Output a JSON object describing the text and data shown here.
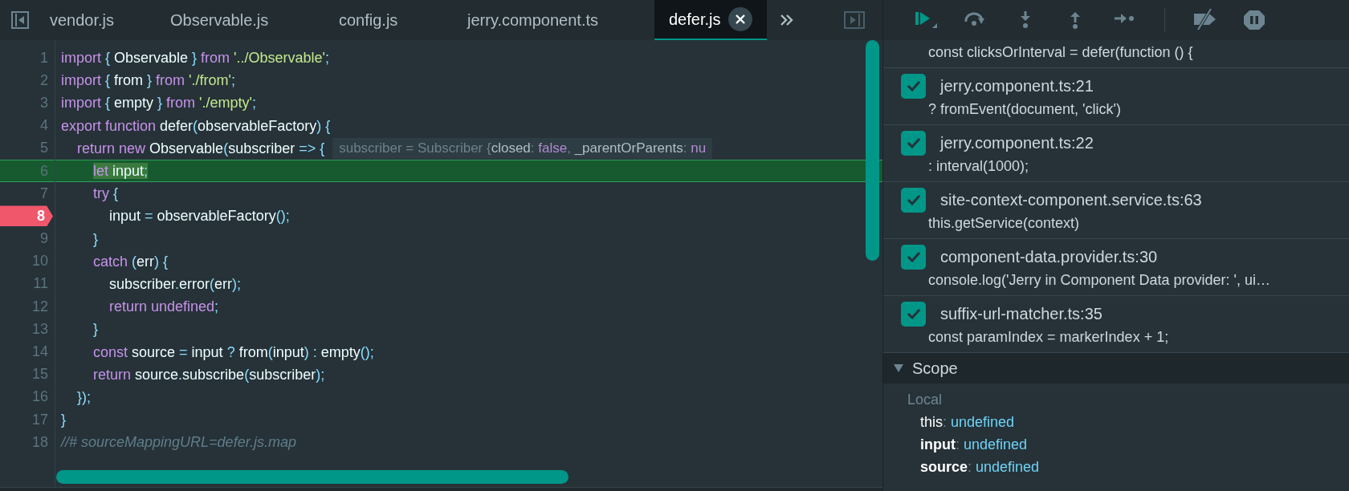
{
  "editor": {
    "tabs": [
      {
        "label": "vendor.js",
        "selected": false
      },
      {
        "label": "Observable.js",
        "selected": false
      },
      {
        "label": "config.js",
        "selected": false
      },
      {
        "label": "jerry.component.ts",
        "selected": false
      },
      {
        "label": "defer.js",
        "selected": true
      }
    ],
    "lines": [
      {
        "number": "1",
        "current": false,
        "breakpoint": false,
        "tokens": [
          {
            "kind": "k",
            "text": "import"
          },
          {
            "kind": "p",
            "text": " { "
          },
          {
            "kind": "t",
            "text": "Observable"
          },
          {
            "kind": "p",
            "text": " } "
          },
          {
            "kind": "k",
            "text": "from"
          },
          {
            "kind": "s",
            "text": " '../Observable'"
          },
          {
            "kind": "p",
            "text": ";"
          }
        ]
      },
      {
        "number": "2",
        "current": false,
        "breakpoint": false,
        "tokens": [
          {
            "kind": "k",
            "text": "import"
          },
          {
            "kind": "p",
            "text": " { "
          },
          {
            "kind": "t",
            "text": "from"
          },
          {
            "kind": "p",
            "text": " } "
          },
          {
            "kind": "k",
            "text": "from"
          },
          {
            "kind": "s",
            "text": " './from'"
          },
          {
            "kind": "p",
            "text": ";"
          }
        ]
      },
      {
        "number": "3",
        "current": false,
        "breakpoint": false,
        "tokens": [
          {
            "kind": "k",
            "text": "import"
          },
          {
            "kind": "p",
            "text": " { "
          },
          {
            "kind": "t",
            "text": "empty"
          },
          {
            "kind": "p",
            "text": " } "
          },
          {
            "kind": "k",
            "text": "from"
          },
          {
            "kind": "s",
            "text": " './empty'"
          },
          {
            "kind": "p",
            "text": ";"
          }
        ]
      },
      {
        "number": "4",
        "current": false,
        "breakpoint": false,
        "tokens": [
          {
            "kind": "k",
            "text": "export function "
          },
          {
            "kind": "t",
            "text": "defer"
          },
          {
            "kind": "p",
            "text": "("
          },
          {
            "kind": "t",
            "text": "observableFactory"
          },
          {
            "kind": "p",
            "text": ") {"
          }
        ]
      },
      {
        "number": "5",
        "current": false,
        "breakpoint": false,
        "tokens": [
          {
            "kind": "k",
            "text": "    return new "
          },
          {
            "kind": "t",
            "text": "Observable"
          },
          {
            "kind": "p",
            "text": "("
          },
          {
            "kind": "t",
            "text": "subscriber "
          },
          {
            "kind": "p",
            "text": "=> {"
          }
        ],
        "hint": [
          {
            "kind": "h",
            "text": "subscriber = Subscriber {"
          },
          {
            "kind": "hk",
            "text": "closed"
          },
          {
            "kind": "h",
            "text": ": "
          },
          {
            "kind": "hv",
            "text": "false"
          },
          {
            "kind": "h",
            "text": ", "
          },
          {
            "kind": "hk",
            "text": "_parentOrParents"
          },
          {
            "kind": "h",
            "text": ": "
          },
          {
            "kind": "hv",
            "text": "nu"
          }
        ]
      },
      {
        "number": "6",
        "current": true,
        "breakpoint": false,
        "tokens": [
          {
            "kind": "k",
            "text": "        let "
          },
          {
            "kind": "t",
            "text": "input"
          },
          {
            "kind": "p",
            "text": ";"
          }
        ]
      },
      {
        "number": "7",
        "current": false,
        "breakpoint": false,
        "tokens": [
          {
            "kind": "k",
            "text": "        try "
          },
          {
            "kind": "p",
            "text": "{"
          }
        ]
      },
      {
        "number": "8",
        "current": false,
        "breakpoint": true,
        "tokens": [
          {
            "kind": "t",
            "text": "            input "
          },
          {
            "kind": "p",
            "text": "= "
          },
          {
            "kind": "t",
            "text": "observableFactory"
          },
          {
            "kind": "p",
            "text": "();"
          }
        ]
      },
      {
        "number": "9",
        "current": false,
        "breakpoint": false,
        "tokens": [
          {
            "kind": "p",
            "text": "        }"
          }
        ]
      },
      {
        "number": "10",
        "current": false,
        "breakpoint": false,
        "tokens": [
          {
            "kind": "k",
            "text": "        catch "
          },
          {
            "kind": "p",
            "text": "("
          },
          {
            "kind": "t",
            "text": "err"
          },
          {
            "kind": "p",
            "text": ") {"
          }
        ]
      },
      {
        "number": "11",
        "current": false,
        "breakpoint": false,
        "tokens": [
          {
            "kind": "t",
            "text": "            subscriber"
          },
          {
            "kind": "p",
            "text": "."
          },
          {
            "kind": "t",
            "text": "error"
          },
          {
            "kind": "p",
            "text": "("
          },
          {
            "kind": "t",
            "text": "err"
          },
          {
            "kind": "p",
            "text": ");"
          }
        ]
      },
      {
        "number": "12",
        "current": false,
        "breakpoint": false,
        "tokens": [
          {
            "kind": "k",
            "text": "            return undefined"
          },
          {
            "kind": "p",
            "text": ";"
          }
        ]
      },
      {
        "number": "13",
        "current": false,
        "breakpoint": false,
        "tokens": [
          {
            "kind": "p",
            "text": "        }"
          }
        ]
      },
      {
        "number": "14",
        "current": false,
        "breakpoint": false,
        "tokens": [
          {
            "kind": "k",
            "text": "        const "
          },
          {
            "kind": "t",
            "text": "source "
          },
          {
            "kind": "p",
            "text": "= "
          },
          {
            "kind": "t",
            "text": "input "
          },
          {
            "kind": "p",
            "text": "? "
          },
          {
            "kind": "t",
            "text": "from"
          },
          {
            "kind": "p",
            "text": "("
          },
          {
            "kind": "t",
            "text": "input"
          },
          {
            "kind": "p",
            "text": ") : "
          },
          {
            "kind": "t",
            "text": "empty"
          },
          {
            "kind": "p",
            "text": "();"
          }
        ]
      },
      {
        "number": "15",
        "current": false,
        "breakpoint": false,
        "tokens": [
          {
            "kind": "k",
            "text": "        return "
          },
          {
            "kind": "t",
            "text": "source"
          },
          {
            "kind": "p",
            "text": "."
          },
          {
            "kind": "t",
            "text": "subscribe"
          },
          {
            "kind": "p",
            "text": "("
          },
          {
            "kind": "t",
            "text": "subscriber"
          },
          {
            "kind": "p",
            "text": ");"
          }
        ]
      },
      {
        "number": "16",
        "current": false,
        "breakpoint": false,
        "tokens": [
          {
            "kind": "p",
            "text": "    });"
          }
        ]
      },
      {
        "number": "17",
        "current": false,
        "breakpoint": false,
        "tokens": [
          {
            "kind": "p",
            "text": "}"
          }
        ]
      },
      {
        "number": "18",
        "current": false,
        "breakpoint": false,
        "tokens": [
          {
            "kind": "c",
            "text": "//# sourceMappingURL=defer.js.map"
          }
        ]
      }
    ]
  },
  "debugger": {
    "toolbar": [
      {
        "kind": "resume"
      },
      {
        "kind": "step-over"
      },
      {
        "kind": "step-into"
      },
      {
        "kind": "step-out"
      },
      {
        "kind": "step"
      },
      {
        "kind": "separator"
      },
      {
        "kind": "deactivate"
      },
      {
        "kind": "pause"
      }
    ],
    "breakpoints": [
      {
        "code": "const clicksOrInterval = defer(function () {"
      },
      {
        "file": "jerry.component.ts:21",
        "checked": true,
        "code": "? fromEvent(document, 'click')"
      },
      {
        "file": "jerry.component.ts:22",
        "checked": true,
        "code": ": interval(1000);"
      },
      {
        "file": "site-context-component.service.ts:63",
        "checked": true,
        "code": "this.getService(context)"
      },
      {
        "file": "component-data.provider.ts:30",
        "checked": true,
        "code": "console.log('Jerry in Component Data provider: ', ui…"
      },
      {
        "file": "suffix-url-matcher.ts:35",
        "checked": true,
        "code": "const paramIndex = markerIndex + 1;"
      }
    ],
    "scope": {
      "title": "Scope",
      "expanded": true,
      "groups": [
        {
          "name": "Local",
          "vars": [
            {
              "name": "this",
              "separator": ":",
              "value": "undefined",
              "bold": false
            },
            {
              "name": "input",
              "separator": ":",
              "value": "undefined",
              "bold": true
            },
            {
              "name": "source",
              "separator": ":",
              "value": "undefined",
              "bold": true
            }
          ]
        }
      ]
    }
  }
}
